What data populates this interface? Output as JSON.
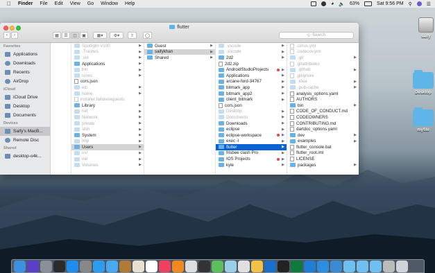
{
  "menubar": {
    "app": "Finder",
    "items": [
      "File",
      "Edit",
      "View",
      "Go",
      "Window",
      "Help"
    ],
    "battery": "63%",
    "clock": "Sat 9:56 PM"
  },
  "desktop": {
    "icons": [
      {
        "label": "saify"
      },
      {
        "label": "Desktop"
      },
      {
        "label": "myfile"
      }
    ]
  },
  "window": {
    "title": "flutter",
    "search_placeholder": "Search",
    "sidebar": {
      "favorites_header": "Favorites",
      "favorites": [
        "Applications",
        "Downloads",
        "Recents",
        "AirDrop"
      ],
      "icloud_header": "iCloud",
      "icloud": [
        "iCloud Drive",
        "Desktop",
        "Documents"
      ],
      "devices_header": "Devices",
      "devices": [
        "Saify's MacB...",
        "Remote Disc"
      ],
      "shared_header": "Shared",
      "shared": [
        "desktop-o4k..."
      ]
    },
    "col1": [
      {
        "name": "Spotlight-V100",
        "dim": true
      },
      {
        "name": ".Trashes",
        "dim": true
      },
      {
        "name": ".vol",
        "dim": true
      },
      {
        "name": "Applications",
        "dim": false
      },
      {
        "name": "bin",
        "dim": true
      },
      {
        "name": "cores",
        "dim": true
      },
      {
        "name": "cors.json",
        "dim": false,
        "file": true
      },
      {
        "name": "etc",
        "dim": true
      },
      {
        "name": "home",
        "dim": true
      },
      {
        "name": "installer.failurerequests",
        "dim": true,
        "file": true
      },
      {
        "name": "Library",
        "dim": false
      },
      {
        "name": "net",
        "dim": true
      },
      {
        "name": "Network",
        "dim": true
      },
      {
        "name": "private",
        "dim": true
      },
      {
        "name": "sbin",
        "dim": true
      },
      {
        "name": "System",
        "dim": false
      },
      {
        "name": "tmp",
        "dim": true
      },
      {
        "name": "Users",
        "dim": false,
        "hl": true
      },
      {
        "name": "usr",
        "dim": true
      },
      {
        "name": "var",
        "dim": true
      },
      {
        "name": "Volumes",
        "dim": true
      }
    ],
    "col2": [
      {
        "name": "Guest"
      },
      {
        "name": "saifykhan",
        "hl": true
      },
      {
        "name": "Shared"
      }
    ],
    "col3": [
      {
        "name": ".vscode",
        "dim": true
      },
      {
        "name": ".xocode",
        "dim": true
      },
      {
        "name": "2d2",
        "dim": false
      },
      {
        "name": "2d2.zip",
        "dim": false,
        "file": true
      },
      {
        "name": "AndroidStudioProjects",
        "dim": false,
        "tag": true
      },
      {
        "name": "Applications",
        "dim": false
      },
      {
        "name": "arcane-ford-34767",
        "dim": false
      },
      {
        "name": "bitmark_app",
        "dim": false
      },
      {
        "name": "bitmark_app2",
        "dim": false
      },
      {
        "name": "client_bitmark",
        "dim": false
      },
      {
        "name": "cors.json",
        "dim": false,
        "file": true
      },
      {
        "name": "Desktop",
        "dim": true
      },
      {
        "name": "Documents",
        "dim": true
      },
      {
        "name": "Downloads",
        "dim": false
      },
      {
        "name": "eclipse",
        "dim": false
      },
      {
        "name": "eclipse-workspace",
        "dim": false,
        "tag": true
      },
      {
        "name": "exec -l",
        "dim": false
      },
      {
        "name": "flutter",
        "dim": false,
        "sel": true
      },
      {
        "name": "frisbee clash Pro",
        "dim": false
      },
      {
        "name": "IOS Projects",
        "dim": false,
        "tag": true
      },
      {
        "name": "kyle",
        "dim": false
      }
    ],
    "col4": [
      {
        "name": ".cirrus.yml",
        "dim": true,
        "file": true
      },
      {
        "name": ".codecov.yml",
        "dim": true,
        "file": true
      },
      {
        "name": ".git",
        "dim": true
      },
      {
        "name": ".gitattributes",
        "dim": true,
        "file": true
      },
      {
        "name": ".github",
        "dim": true
      },
      {
        "name": ".gitignore",
        "dim": true,
        "file": true
      },
      {
        "name": ".idea",
        "dim": true
      },
      {
        "name": ".pub-cache",
        "dim": true
      },
      {
        "name": "analysis_options.yaml",
        "dim": false,
        "file": true
      },
      {
        "name": "AUTHORS",
        "dim": false,
        "file": true
      },
      {
        "name": "bin",
        "dim": false
      },
      {
        "name": "CODE_OF_CONDUCT.md",
        "dim": false,
        "file": true
      },
      {
        "name": "CODEOWNERS",
        "dim": false,
        "file": true
      },
      {
        "name": "CONTRIBUTING.md",
        "dim": false,
        "file": true
      },
      {
        "name": "dartdoc_options.yaml",
        "dim": false,
        "file": true
      },
      {
        "name": "dev",
        "dim": false
      },
      {
        "name": "examples",
        "dim": false
      },
      {
        "name": "flutter_console.bat",
        "dim": false,
        "file": true
      },
      {
        "name": "flutter_root.iml",
        "dim": false,
        "file": true
      },
      {
        "name": "LICENSE",
        "dim": false,
        "file": true
      },
      {
        "name": "packages",
        "dim": false
      }
    ]
  },
  "dock": {
    "apps": [
      {
        "name": "finder-icon",
        "color": "#3d8fe0"
      },
      {
        "name": "siri-icon",
        "color": "#5b3fc8"
      },
      {
        "name": "launchpad-icon",
        "color": "#8a8f99"
      },
      {
        "name": "mission-control-icon",
        "color": "#2b2b2b"
      },
      {
        "name": "app-store-icon",
        "color": "#1f8cf0"
      },
      {
        "name": "system-prefs-icon",
        "color": "#888888"
      },
      {
        "name": "safari-icon",
        "color": "#2d9cf0"
      },
      {
        "name": "mail-icon",
        "color": "#4aa8ef"
      },
      {
        "name": "notes-icon",
        "color": "#b07a3a"
      },
      {
        "name": "photos-icon",
        "color": "#e8e0d0"
      },
      {
        "name": "calendar-icon",
        "color": "#ffffff"
      },
      {
        "name": "music-icon",
        "color": "#f04060"
      },
      {
        "name": "books-icon",
        "color": "#f08a20"
      },
      {
        "name": "chrome-icon",
        "color": "#dddddd"
      },
      {
        "name": "dashboard-icon",
        "color": "#333333"
      },
      {
        "name": "maps-icon",
        "color": "#5bbf5b"
      },
      {
        "name": "preview-icon",
        "color": "#9acfe8"
      },
      {
        "name": "chrome2-icon",
        "color": "#e0e0e0"
      },
      {
        "name": "photos2-icon",
        "color": "#f2c14a"
      },
      {
        "name": "xcode-icon",
        "color": "#1a6fc8"
      },
      {
        "name": "activity-icon",
        "color": "#222222"
      },
      {
        "name": "terminal-icon",
        "color": "#0e7a3d"
      },
      {
        "name": "vscode-icon",
        "color": "#1f7dd6"
      },
      {
        "name": "screen-icon",
        "color": "#2c8ee0"
      },
      {
        "name": "vm-icon",
        "color": "#3a8bd1"
      },
      {
        "name": "folder-icon",
        "color": "#6fc0f0"
      },
      {
        "name": "folder2-icon",
        "color": "#6fc0f0"
      },
      {
        "name": "folder3-icon",
        "color": "#6fc0f0"
      },
      {
        "name": "doc-icon",
        "color": "#bbbbbb"
      },
      {
        "name": "trash-icon",
        "color": "#cfd4d8"
      }
    ]
  }
}
